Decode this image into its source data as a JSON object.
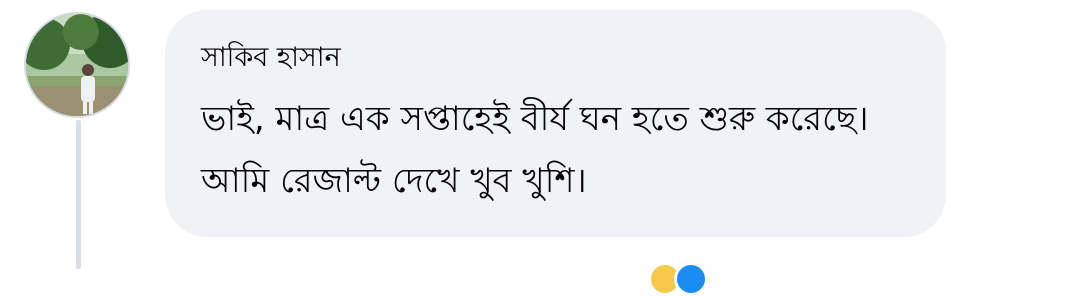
{
  "comment": {
    "author": "সাকিব হাসান",
    "text": "ভাই, মাত্র এক সপ্তাহেই বীর্য ঘন হতে শুরু করেছে। আমি রেজাল্ট দেখে খুব খুশি।"
  },
  "reactions": [
    "haha-icon",
    "like-icon"
  ],
  "colors": {
    "bubble": "#f0f2f5",
    "text": "#050505",
    "thread_line": "#dadde1",
    "haha": "#f7c94b",
    "like": "#1b8cf2"
  }
}
